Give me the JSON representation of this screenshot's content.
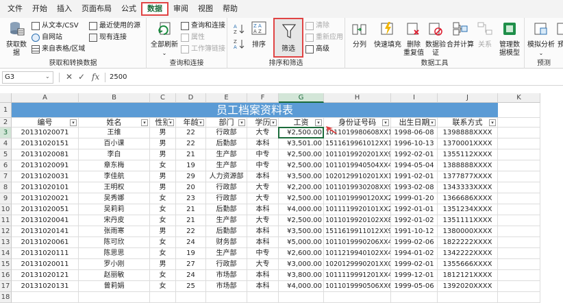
{
  "menu": [
    "文件",
    "开始",
    "插入",
    "页面布局",
    "公式",
    "数据",
    "审阅",
    "视图",
    "帮助"
  ],
  "ribbon": {
    "get_data": "获取数\n据",
    "from_text": "从文本/CSV",
    "from_web": "自网站",
    "from_table": "来自表格/区域",
    "recent_sources": "最近使用的源",
    "existing_conn": "现有连接",
    "group_get": "获取和转换数据",
    "refresh_all": "全部刷新",
    "queries_conn": "查询和连接",
    "properties": "属性",
    "edit_links": "工作簿链接",
    "group_query": "查询和连接",
    "sort": "排序",
    "filter": "筛选",
    "clear": "清除",
    "reapply": "重新应用",
    "advanced": "高级",
    "group_sort": "排序和筛选",
    "split": "分列",
    "flash_fill": "快速填充",
    "remove_dup": "删除\n重复值",
    "validation": "数据验\n证",
    "consolidate": "合并计算",
    "relations": "关系",
    "data_model": "管理数\n据模型",
    "group_tools": "数据工具",
    "whatif": "模拟分析",
    "forecast_sheet": "预",
    "group_forecast": "预测"
  },
  "formula_bar": {
    "name_box": "G3",
    "fx": "fx",
    "value": "2500"
  },
  "columns": [
    "A",
    "B",
    "C",
    "D",
    "E",
    "F",
    "G",
    "H",
    "I",
    "J",
    "K"
  ],
  "rows": [
    "1",
    "2",
    "3",
    "4",
    "5",
    "6",
    "7",
    "8",
    "9",
    "10",
    "11",
    "12",
    "13",
    "14",
    "15",
    "16",
    "17",
    "18"
  ],
  "sheet_title": "员工档案资料表",
  "headers": [
    "编号",
    "姓名",
    "性别",
    "年龄",
    "部门",
    "学历",
    "工资",
    "身份证号码",
    "出生日期",
    "联系方式"
  ],
  "data": [
    [
      "20131020071",
      "王维",
      "男",
      "22",
      "行政部",
      "大专",
      "¥2,500.00",
      "101101998060​8XX1",
      "1998-06-08",
      "1398888XXXX"
    ],
    [
      "20131020151",
      "百小课",
      "男",
      "22",
      "后勤部",
      "本科",
      "¥3,501.00",
      "151161996101​2XX1",
      "1996-10-13",
      "1370001XXXX"
    ],
    [
      "20131020081",
      "李白",
      "男",
      "21",
      "生产部",
      "中专",
      "¥2,500.00",
      "101101992020​1XX9",
      "1992-02-01",
      "1355112XXXX"
    ],
    [
      "20131020091",
      "章东梅",
      "女",
      "19",
      "生产部",
      "中专",
      "¥2,500.00",
      "101101994050​4XX4",
      "1994-05-04",
      "1388888XXXX"
    ],
    [
      "20131020031",
      "李佳航",
      "男",
      "29",
      "人力资源部",
      "本科",
      "¥3,500.00",
      "102012991020​1XX1",
      "1991-02-01",
      "1377877XXXX"
    ],
    [
      "20131020101",
      "王明权",
      "男",
      "20",
      "行政部",
      "大专",
      "¥2,200.00",
      "101101993020​8XX9",
      "1993-02-08",
      "1343333XXXX"
    ],
    [
      "20131020021",
      "吴秀娜",
      "女",
      "23",
      "行政部",
      "大专",
      "¥2,500.00",
      "101101999012​0XX2",
      "1999-01-20",
      "1366686XXXX"
    ],
    [
      "20131020051",
      "吴莉莉",
      "女",
      "21",
      "后勤部",
      "本科",
      "¥4,000.00",
      "101111992010​1XX2",
      "1992-01-01",
      "1351234XXXX"
    ],
    [
      "20131020041",
      "宋丹皮",
      "女",
      "21",
      "生产部",
      "大专",
      "¥2,500.00",
      "101101992010​2XX8",
      "1992-01-02",
      "1351111XXXX"
    ],
    [
      "20131020141",
      "张雨寒",
      "男",
      "22",
      "后勤部",
      "本科",
      "¥3,500.00",
      "151161991101​2XX9",
      "1991-10-12",
      "1380000XXXX"
    ],
    [
      "20131020061",
      "陈可欣",
      "女",
      "24",
      "财务部",
      "本科",
      "¥5,000.00",
      "101101999020​6XX4",
      "1999-02-06",
      "1822222XXXX"
    ],
    [
      "20131020111",
      "陈思思",
      "女",
      "19",
      "生产部",
      "中专",
      "¥2,600.00",
      "101121994010​2XX4",
      "1994-01-02",
      "1342222XXXX"
    ],
    [
      "20131020011",
      "罗小刚",
      "男",
      "27",
      "行政部",
      "大专",
      "¥3,000.00",
      "102012999020​1XX0",
      "1999-02-01",
      "1355666XXXX"
    ],
    [
      "20131020121",
      "赵丽敏",
      "女",
      "24",
      "市场部",
      "本科",
      "¥3,800.00",
      "101111999120​1XX4",
      "1999-12-01",
      "1812121XXXX"
    ],
    [
      "20131020131",
      "曾莉娟",
      "女",
      "25",
      "市场部",
      "本科",
      "¥4,000.00",
      "101101999050​6XX6",
      "1999-05-06",
      "1392020XXXX"
    ]
  ],
  "colors": {
    "accent": "#1a6b3a",
    "title_band": "#5b9bd5",
    "highlight": "#e04343"
  }
}
